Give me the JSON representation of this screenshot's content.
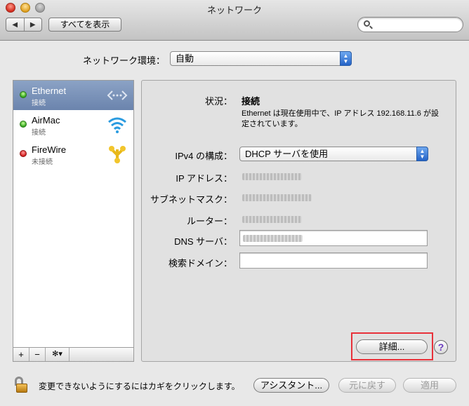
{
  "window": {
    "title": "ネットワーク"
  },
  "toolbar": {
    "back_glyph": "◀",
    "forward_glyph": "▶",
    "show_all_label": "すべてを表示",
    "search_value": ""
  },
  "location": {
    "label": "ネットワーク環境：",
    "value": "自動"
  },
  "services": [
    {
      "name": "Ethernet",
      "status": "接続",
      "indicator": "green",
      "icon": "ethernet-icon",
      "selected": true
    },
    {
      "name": "AirMac",
      "status": "接続",
      "indicator": "green",
      "icon": "wifi-icon",
      "selected": false
    },
    {
      "name": "FireWire",
      "status": "未接続",
      "indicator": "red",
      "icon": "firewire-icon",
      "selected": false
    }
  ],
  "list_footer": {
    "add": "+",
    "remove": "−",
    "gear": "✻▾"
  },
  "detail": {
    "status_label": "状況：",
    "status_value": "接続",
    "status_desc_line1": "Ethernet は現在使用中で、IP アドレス 192.168.11.6 が設",
    "status_desc_line2": "定されています。",
    "ipv4_label": "IPv4 の構成：",
    "ipv4_value": "DHCP サーバを使用",
    "ip_label": "IP アドレス：",
    "subnet_label": "サブネットマスク：",
    "router_label": "ルーター：",
    "dns_label": "DNS サーバ：",
    "search_domain_label": "検索ドメイン：",
    "advanced_label": "詳細...",
    "help_label": "?"
  },
  "bottom": {
    "lock_text": "変更できないようにするにはカギをクリックします。",
    "assistant_label": "アシスタント...",
    "revert_label": "元に戻す",
    "apply_label": "適用"
  },
  "colors": {
    "selection": "#7189b3",
    "focus_ring": "#e8313a",
    "popup_accent": "#2f6fd6"
  }
}
